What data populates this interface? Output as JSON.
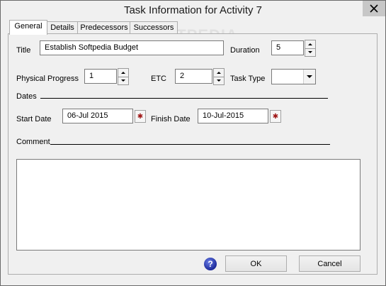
{
  "window": {
    "title": "Task Information for Activity  7",
    "watermark": "SOFTPEDIA"
  },
  "tabs": [
    {
      "label": "General",
      "active": true
    },
    {
      "label": "Details",
      "active": false
    },
    {
      "label": "Predecessors",
      "active": false
    },
    {
      "label": "Successors",
      "active": false
    }
  ],
  "form": {
    "title_label": "Title",
    "title_value": "Establish Softpedia Budget",
    "duration_label": "Duration",
    "duration_value": "5",
    "physical_progress_label": "Physical Progress",
    "physical_progress_value": "1",
    "etc_label": "ETC",
    "etc_value": "2",
    "task_type_label": "Task Type",
    "task_type_value": "",
    "dates_label": "Dates",
    "start_date_label": "Start Date",
    "start_date_value": "06-Jul 2015",
    "finish_date_label": "Finish Date",
    "finish_date_value": "10-Jul-2015",
    "comment_label": "Comment",
    "comment_value": ""
  },
  "buttons": {
    "ok_label": "OK",
    "cancel_label": "Cancel",
    "help_glyph": "?"
  },
  "icons": {
    "close": "close-icon",
    "date_picker": "star-icon",
    "help": "help-icon"
  },
  "colors": {
    "close_button_bg": "#c7c7c7",
    "date_icon": "#a01818",
    "help_icon": "#1d2a9a"
  }
}
